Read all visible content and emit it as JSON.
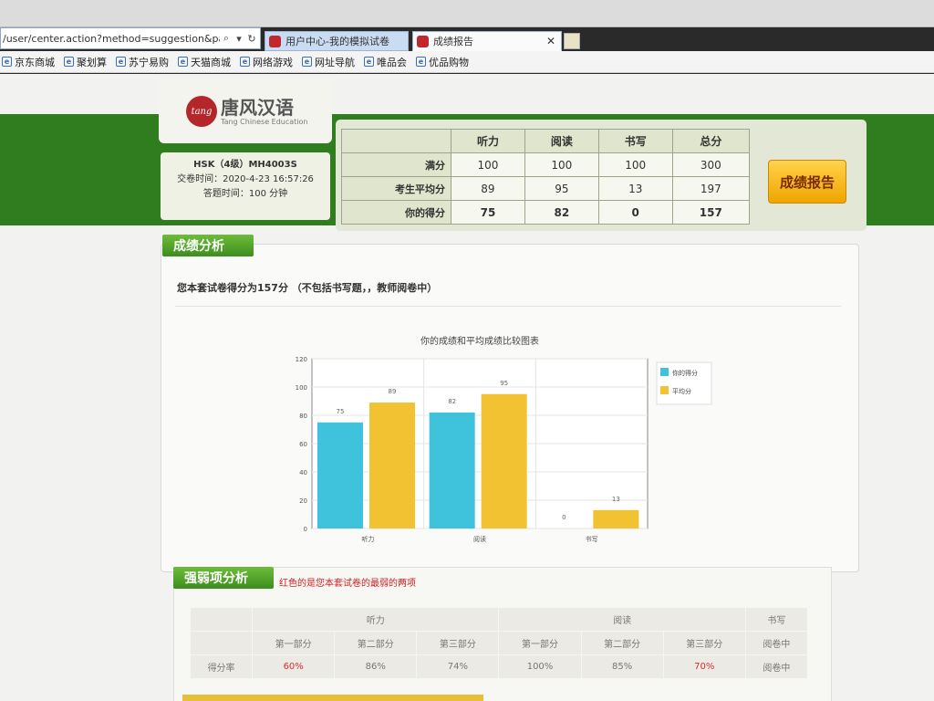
{
  "browser": {
    "address": "/user/center.action?method=suggestion&paperListe",
    "tabs": [
      {
        "label": "用户中心-我的模拟试卷"
      },
      {
        "label": "成绩报告"
      }
    ],
    "bookmarks": [
      "京东商城",
      "聚划算",
      "苏宁易购",
      "天猫商城",
      "网络游戏",
      "网址导航",
      "唯品会",
      "优品购物"
    ]
  },
  "logo": {
    "mark": "tang",
    "name_cn": "唐风汉语",
    "name_en": "Tang Chinese Education"
  },
  "exam_info": {
    "exam": "HSK（4级）MH4003S",
    "submit_time": "交卷时间：2020-4-23 16:57:26",
    "duration": "答题时间：100 分钟"
  },
  "scores": {
    "columns": [
      "听力",
      "阅读",
      "书写",
      "总分"
    ],
    "rows": [
      {
        "label": "满分",
        "values": [
          "100",
          "100",
          "100",
          "300"
        ]
      },
      {
        "label": "考生平均分",
        "values": [
          "89",
          "95",
          "13",
          "197"
        ]
      },
      {
        "label": "你的得分",
        "values": [
          "75",
          "82",
          "0",
          "157"
        ]
      }
    ],
    "report_button": "成绩报告"
  },
  "analysis": {
    "heading": "成绩分析",
    "summary": "您本套试卷得分为157分 （不包括书写题，，教师阅卷中）"
  },
  "chart_data": {
    "type": "bar",
    "title": "你的成绩和平均成绩比较图表",
    "categories": [
      "听力",
      "阅读",
      "书写"
    ],
    "series": [
      {
        "name": "你的得分",
        "values": [
          75,
          82,
          0
        ],
        "color": "#3fc2dc"
      },
      {
        "name": "平均分",
        "values": [
          89,
          95,
          13
        ],
        "color": "#f2c232"
      }
    ],
    "ylim": [
      0,
      120
    ],
    "yticks": [
      0,
      20,
      40,
      60,
      80,
      100,
      120
    ],
    "grid": true,
    "legend": "right"
  },
  "weak": {
    "heading": "强弱项分析",
    "note": "红色的是您本套试卷的最弱的两项",
    "groups": [
      "听力",
      "阅读",
      "书写"
    ],
    "parts": [
      "第一部分",
      "第二部分",
      "第三部分",
      "第一部分",
      "第二部分",
      "第三部分"
    ],
    "row_label": "得分率",
    "rates": [
      "60%",
      "86%",
      "74%",
      "100%",
      "85%",
      "70%"
    ],
    "writing_status": [
      "阅卷中",
      "阅卷中"
    ],
    "highlight_color": "#d83030"
  }
}
